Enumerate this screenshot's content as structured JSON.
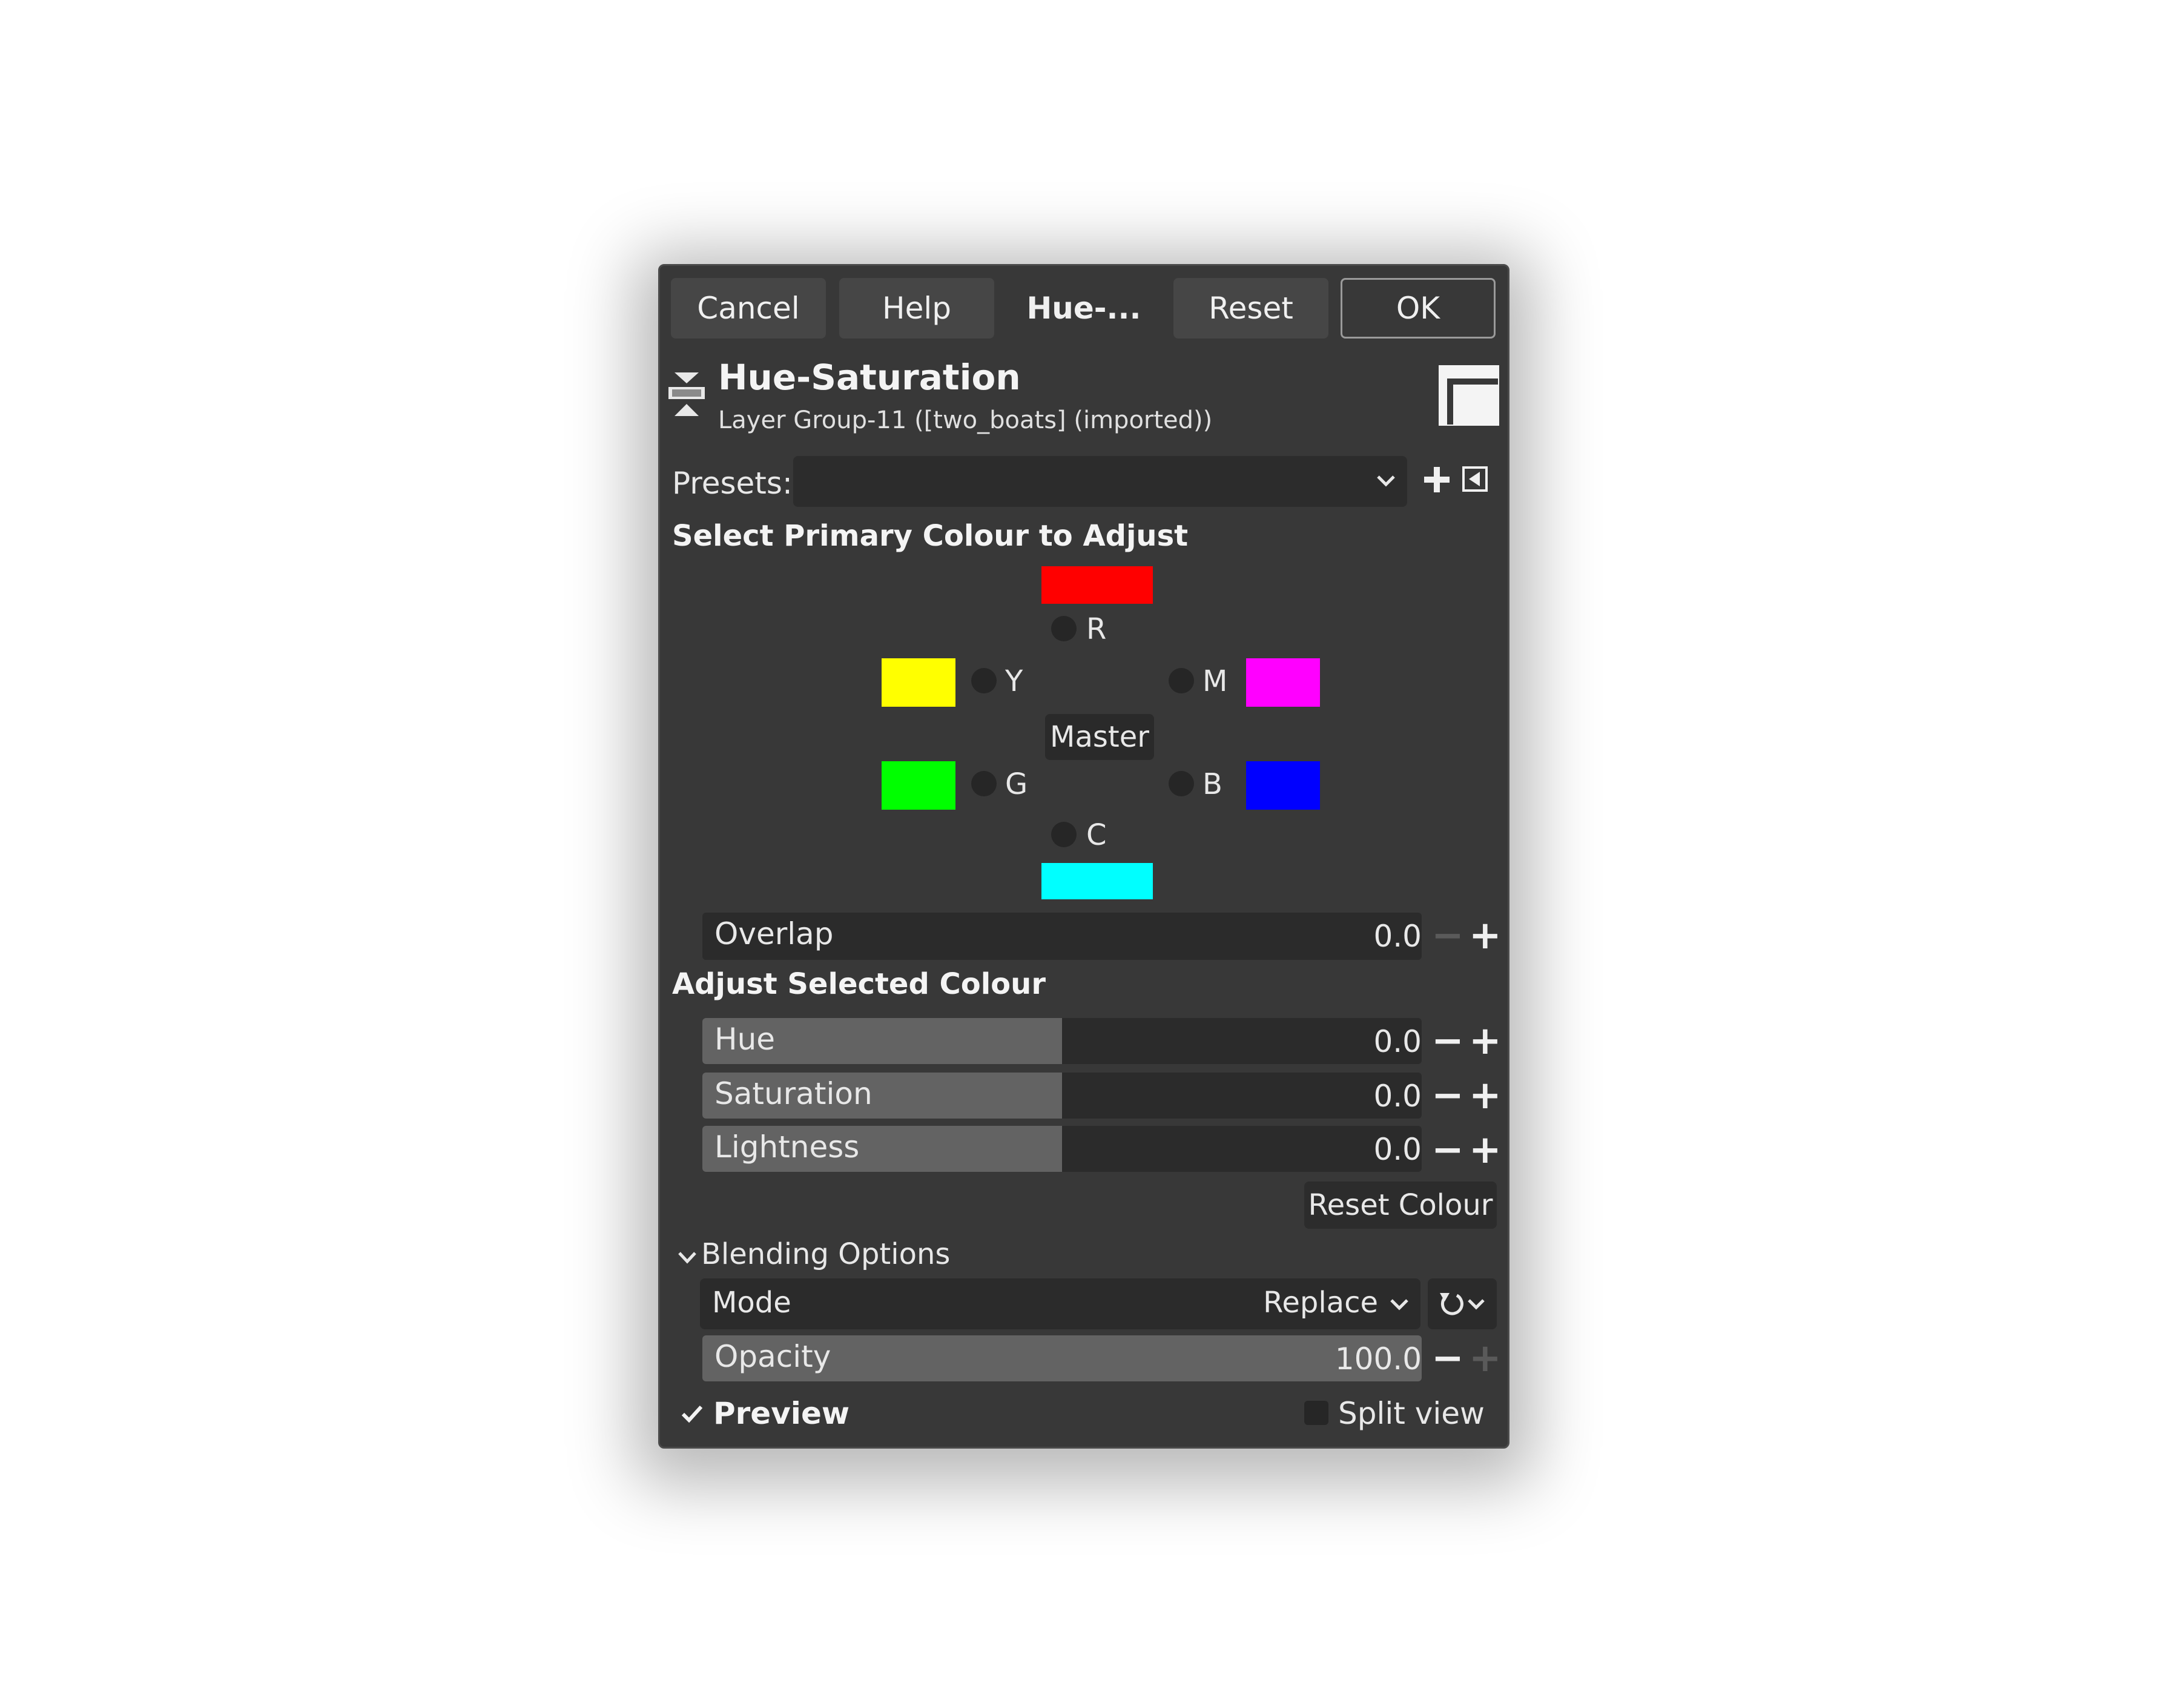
{
  "buttons": {
    "cancel": "Cancel",
    "help": "Help",
    "title_tab": "Hue-...",
    "reset": "Reset",
    "ok": "OK"
  },
  "header": {
    "title": "Hue-Saturation",
    "subtitle": "Layer Group-11 ([two_boats] (imported))"
  },
  "presets": {
    "label": "Presets:",
    "value": ""
  },
  "primary": {
    "heading": "Select Primary Colour to Adjust",
    "r": "R",
    "y": "Y",
    "m": "M",
    "g": "G",
    "b": "B",
    "c": "C",
    "master": "Master",
    "colors": {
      "red": "#ff0000",
      "yellow": "#ffff00",
      "magenta": "#ff00ff",
      "green": "#00ff00",
      "blue": "#0000ff",
      "cyan": "#00ffff"
    }
  },
  "overlap": {
    "label": "Overlap",
    "value": "0.0"
  },
  "adjust": {
    "heading": "Adjust Selected Colour",
    "hue": {
      "label": "Hue",
      "value": "0.0"
    },
    "saturation": {
      "label": "Saturation",
      "value": "0.0"
    },
    "lightness": {
      "label": "Lightness",
      "value": "0.0"
    },
    "reset_colour": "Reset Colour"
  },
  "blending": {
    "heading": "Blending Options",
    "mode_label": "Mode",
    "mode_value": "Replace",
    "opacity_label": "Opacity",
    "opacity_value": "100.0"
  },
  "footer": {
    "preview": "Preview",
    "split_view": "Split view"
  }
}
